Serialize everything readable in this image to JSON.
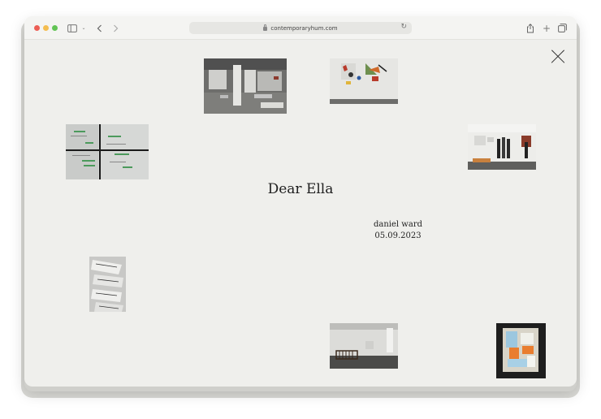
{
  "browser": {
    "url": "contemporaryhum.com",
    "traffic_lights": [
      "#ec5e55",
      "#f4bd4f",
      "#62c454"
    ]
  },
  "overlay": {
    "title": "Dear Ella",
    "author": "daniel ward",
    "date": "05.09.2023"
  },
  "thumbnails": [
    {
      "name": "gallery-room"
    },
    {
      "name": "wall-artwork"
    },
    {
      "name": "map-drawing"
    },
    {
      "name": "visitors"
    },
    {
      "name": "printed-sheets"
    },
    {
      "name": "crib-room"
    },
    {
      "name": "color-collage"
    }
  ]
}
